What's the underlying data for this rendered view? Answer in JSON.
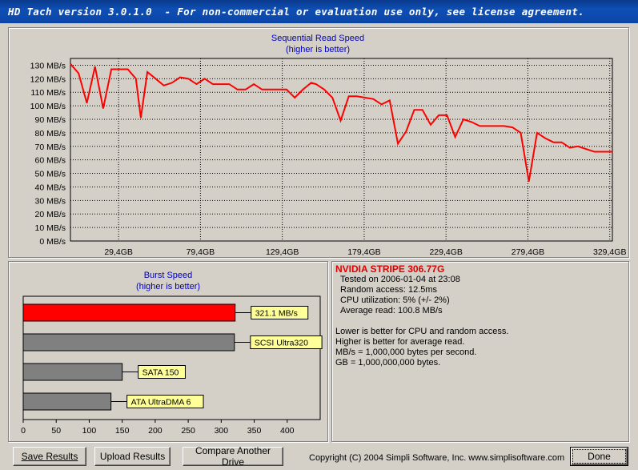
{
  "window": {
    "title": "HD Tach version 3.0.1.0  - For non-commercial or evaluation use only, see license agreement."
  },
  "seq_chart": {
    "title": "Sequential Read Speed",
    "subtitle": "(higher is better)",
    "line_color": "#ff0000",
    "chart_data": {
      "type": "line",
      "title": "Sequential Read Speed",
      "subtitle": "(higher is better)",
      "y_ticks": [
        "0 MB/s",
        "10 MB/s",
        "20 MB/s",
        "30 MB/s",
        "40 MB/s",
        "50 MB/s",
        "60 MB/s",
        "70 MB/s",
        "80 MB/s",
        "90 MB/s",
        "100 MB/s",
        "110 MB/s",
        "120 MB/s",
        "130 MB/s"
      ],
      "x_ticks": [
        "29,4GB",
        "79,4GB",
        "129,4GB",
        "179,4GB",
        "229,4GB",
        "279,4GB",
        "329,4GB"
      ],
      "x_tick_values": [
        29.4,
        79.4,
        129.4,
        179.4,
        229.4,
        279.4,
        329.4
      ],
      "xlim": [
        0,
        331
      ],
      "ylim": [
        0,
        135
      ],
      "grid": true,
      "x": [
        0,
        5,
        10,
        15,
        20,
        25,
        30,
        35,
        40,
        43,
        47,
        52,
        57,
        62,
        67,
        72,
        77,
        82,
        87,
        92,
        97,
        102,
        107,
        112,
        117,
        122,
        127,
        132,
        137,
        142,
        147,
        150,
        155,
        160,
        165,
        170,
        175,
        180,
        185,
        190,
        195,
        200,
        205,
        210,
        215,
        220,
        225,
        230,
        235,
        240,
        245,
        250,
        255,
        260,
        265,
        270,
        275,
        280,
        285,
        290,
        295,
        300,
        305,
        310,
        315,
        320,
        325,
        331
      ],
      "y": [
        131,
        124,
        102,
        129,
        98,
        127,
        127,
        127,
        120,
        91,
        125,
        120,
        115,
        117,
        121,
        120,
        116,
        120,
        116,
        116,
        116,
        112,
        112,
        116,
        112,
        112,
        112,
        112,
        106,
        112,
        117,
        116,
        112,
        106,
        89,
        107,
        107,
        106,
        105,
        101,
        104,
        72,
        81,
        97,
        97,
        86,
        93,
        93,
        77,
        90,
        88,
        85,
        85,
        85,
        85,
        84,
        80,
        44,
        80,
        76,
        73,
        73,
        69,
        70,
        68,
        66,
        66,
        66
      ]
    }
  },
  "burst_chart": {
    "title": "Burst Speed",
    "subtitle": "(higher is better)",
    "chart_data": {
      "type": "bar",
      "orientation": "horizontal",
      "categories": [
        "321.1 MB/s",
        "SCSI Ultra320",
        "SATA 150",
        "ATA UltraDMA 6"
      ],
      "values": [
        321.1,
        320,
        150,
        133
      ],
      "colors": [
        "#ff0000",
        "#808080",
        "#808080",
        "#808080"
      ],
      "x_ticks": [
        "0",
        "50",
        "100",
        "150",
        "200",
        "250",
        "300",
        "350",
        "400"
      ],
      "xlim": [
        0,
        450
      ]
    }
  },
  "info": {
    "drive_name": "NVIDIA STRIPE 306.77G",
    "tested_on": "Tested on 2006-01-04 at 23:08",
    "random_access": "Random access: 12.5ms",
    "cpu_utilization": "CPU utilization: 5% (+/- 2%)",
    "average_read": "Average read: 100.8 MB/s",
    "note1": "Lower is better for CPU and random access.",
    "note2": "Higher is better for average read.",
    "note3": "MB/s = 1,000,000 bytes per second.",
    "note4": "GB = 1,000,000,000 bytes."
  },
  "buttons": {
    "save": "Save Results",
    "upload": "Upload Results",
    "compare": "Compare Another Drive",
    "done": "Done"
  },
  "footer": {
    "copyright": "Copyright (C) 2004 Simpli Software, Inc. www.simplisoftware.com"
  }
}
